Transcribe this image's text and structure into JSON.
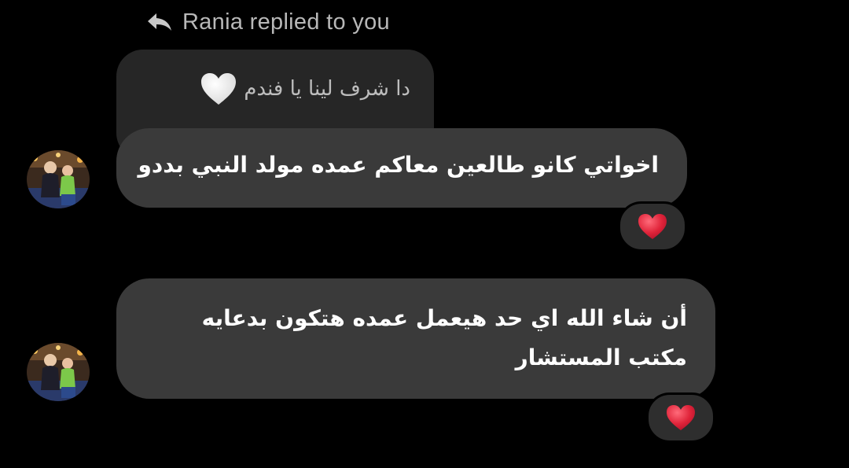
{
  "reply_header": {
    "text": "Rania replied to you",
    "icon": "reply-arrow-icon"
  },
  "quoted_message": {
    "text": "دا شرف لينا يا فندم",
    "emoji": "white-heart-icon"
  },
  "messages": [
    {
      "text": "اخواتي كانو طالعين معاكم عمده مولد النبي بددو",
      "reaction": "red-heart-icon"
    },
    {
      "text": "أن شاء الله اي حد هيعمل عمده هتكون بدعايه مكتب المستشار",
      "reaction": "red-heart-icon"
    }
  ],
  "colors": {
    "background": "#000000",
    "bubble": "#3a3a3a",
    "quoted_bubble": "#262626",
    "reaction_pill": "#2e2e2e",
    "heart_red": "#e0243a"
  }
}
